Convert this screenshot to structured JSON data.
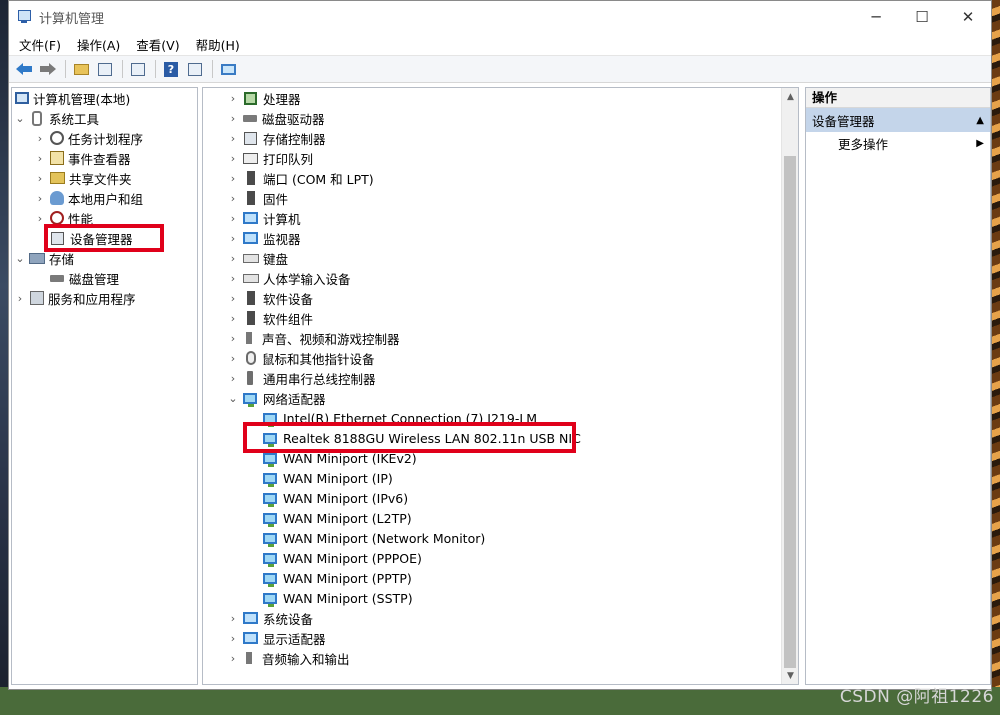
{
  "window": {
    "title": "计算机管理",
    "minimize": "─",
    "maximize": "☐",
    "close": "✕"
  },
  "menubar": [
    "文件(F)",
    "操作(A)",
    "查看(V)",
    "帮助(H)"
  ],
  "left_tree": {
    "root": "计算机管理(本地)",
    "system_tools": "系统工具",
    "task_scheduler": "任务计划程序",
    "event_viewer": "事件查看器",
    "shared_folders": "共享文件夹",
    "local_users": "本地用户和组",
    "performance": "性能",
    "device_manager": "设备管理器",
    "storage": "存储",
    "disk_management": "磁盘管理",
    "services": "服务和应用程序"
  },
  "device_tree": {
    "categories_top": [
      {
        "label": "处理器",
        "icon": "processor-icon"
      },
      {
        "label": "磁盘驱动器",
        "icon": "disk-drive-icon"
      },
      {
        "label": "存储控制器",
        "icon": "storage-controller-icon"
      },
      {
        "label": "打印队列",
        "icon": "printer-icon"
      },
      {
        "label": "端口 (COM 和 LPT)",
        "icon": "port-icon"
      },
      {
        "label": "固件",
        "icon": "firmware-icon"
      },
      {
        "label": "计算机",
        "icon": "computer-icon"
      },
      {
        "label": "监视器",
        "icon": "monitor-icon"
      },
      {
        "label": "键盘",
        "icon": "keyboard-icon"
      },
      {
        "label": "人体学输入设备",
        "icon": "hid-icon"
      },
      {
        "label": "软件设备",
        "icon": "software-device-icon"
      },
      {
        "label": "软件组件",
        "icon": "software-component-icon"
      },
      {
        "label": "声音、视频和游戏控制器",
        "icon": "sound-icon"
      },
      {
        "label": "鼠标和其他指针设备",
        "icon": "mouse-icon"
      },
      {
        "label": "通用串行总线控制器",
        "icon": "usb-icon"
      }
    ],
    "network_category": "网络适配器",
    "network_adapters": [
      "Intel(R) Ethernet Connection (7) I219-LM",
      "Realtek 8188GU Wireless LAN 802.11n USB NIC",
      "WAN Miniport (IKEv2)",
      "WAN Miniport (IP)",
      "WAN Miniport (IPv6)",
      "WAN Miniport (L2TP)",
      "WAN Miniport (Network Monitor)",
      "WAN Miniport (PPPOE)",
      "WAN Miniport (PPTP)",
      "WAN Miniport (SSTP)"
    ],
    "categories_bottom": [
      {
        "label": "系统设备",
        "icon": "system-device-icon"
      },
      {
        "label": "显示适配器",
        "icon": "display-adapter-icon"
      },
      {
        "label": "音频输入和输出",
        "icon": "audio-io-icon"
      }
    ]
  },
  "actions": {
    "header": "操作",
    "section": "设备管理器",
    "more": "更多操作"
  },
  "watermark": "CSDN @阿祖1226",
  "colors": {
    "highlight": "#e0001a",
    "action_section_bg": "#c4d5ea"
  }
}
